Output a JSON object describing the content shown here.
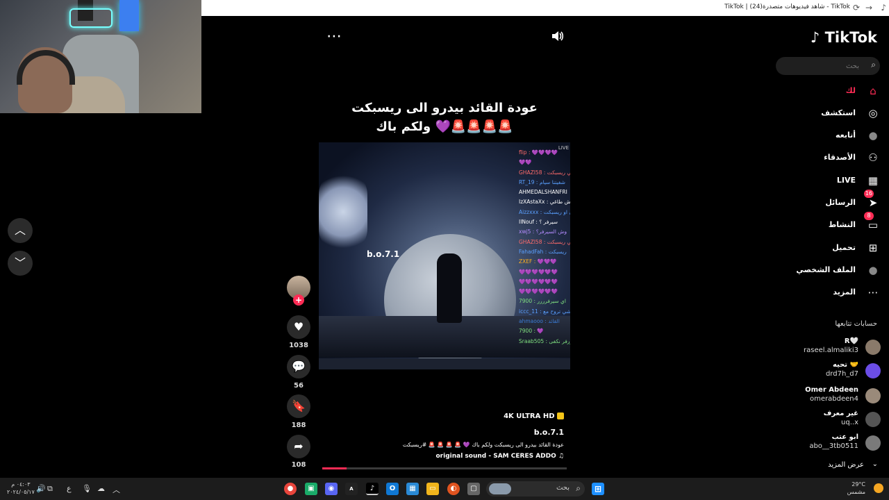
{
  "window": {
    "title": "TikTok | شاهد فيديوهات متصدرة(24) - TikTok",
    "reload_icon": "reload-icon",
    "forward_icon": "arrow-forward-icon",
    "app_icon": "tiktok-icon"
  },
  "feed_nav": {
    "up_icon": "chevron-up-icon",
    "down_icon": "chevron-down-icon"
  },
  "video": {
    "caption_overlay": [
      "عودة القائد بيدرو الى ريسبكت",
      "ولكم باك 💜🚨🚨🚨🚨"
    ],
    "watermark": "b.o.7.1",
    "live_label": "LIVE",
    "chat_lines": [
      {
        "text": "flip : 💜💜💜💜",
        "color": "#ff6b6b"
      },
      {
        "text": "💜💜",
        "color": "#b58cff"
      },
      {
        "text": "GHAZI58 : نبي ريسبكت",
        "color": "#ff6b6b"
      },
      {
        "text": "RT_19 : شفيتنا سيام",
        "color": "#5aa0ff"
      },
      {
        "text": "AHMEDALSHANFRI",
        "color": "#ffffff"
      },
      {
        "text": "IzXAstaXx : وش طاغي",
        "color": "#ffffff"
      },
      {
        "text": "Aizzxxx : تي او ريسبكت",
        "color": "#5aa0ff"
      },
      {
        "text": "IINouf : سيرفر ؟",
        "color": "#ffffff"
      },
      {
        "text": "xwj5 : وش السيرفر؟",
        "color": "#b58cff"
      },
      {
        "text": "GHAZI58 : نبي ريسبكت",
        "color": "#ff6b6b"
      },
      {
        "text": "FahadFah : ريسبكت",
        "color": "#5aa0ff"
      },
      {
        "text": "ZXEF : 💜💜💜",
        "color": "#ffb020"
      },
      {
        "text": "💜💜💜💜💜💜",
        "color": "#b58cff"
      },
      {
        "text": "💜💜💜💜💜💜",
        "color": "#b58cff"
      },
      {
        "text": "💜💜💜💜💜💜",
        "color": "#b58cff"
      },
      {
        "text": "7900 : اي سيرفرررر",
        "color": "#7fe07f"
      },
      {
        "text": "iccc_11 : شي تروح مع",
        "color": "#5aa0ff"
      },
      {
        "text": "ahmaooo : القائد",
        "color": "#3a7bd5"
      },
      {
        "text": "7900 : 💜",
        "color": "#7fe07f"
      },
      {
        "text": "Sraab505 : ررفر نكفى",
        "color": "#7fe07f"
      }
    ],
    "menu_icon": "more-horizontal-icon",
    "sound_icon": "speaker-icon"
  },
  "actions": {
    "like_count": "1038",
    "comment_count": "56",
    "save_count": "188",
    "share_count": "108",
    "like_icon": "heart-icon",
    "comment_icon": "comment-icon",
    "save_icon": "bookmark-icon",
    "share_icon": "share-icon",
    "follow_icon": "plus-icon"
  },
  "description": {
    "quality_badge": "4K ULTRA HD",
    "author": "b.o.7.1",
    "text": "عودة القائد بيدرو الى ريسبكت  ولكم باك 💜 🚨 🚨 🚨 🚨 #ريسبكت",
    "sound": "original sound - SAM CERES ADDO",
    "progress": 0.1
  },
  "sidebar": {
    "logo": "TikTok",
    "search_placeholder": "بحث",
    "nav": [
      {
        "label": "لك",
        "icon": "home-icon",
        "active": true
      },
      {
        "label": "استكشف",
        "icon": "compass-icon"
      },
      {
        "label": "أتابعه",
        "icon": "following-avatar-icon"
      },
      {
        "label": "الأصدقاء",
        "icon": "friends-icon"
      },
      {
        "label": "LIVE",
        "icon": "live-icon"
      },
      {
        "label": "الرسائل",
        "icon": "send-icon",
        "badge": "16"
      },
      {
        "label": "النشاط",
        "icon": "inbox-icon",
        "badge": "8"
      },
      {
        "label": "تحميل",
        "icon": "upload-icon"
      },
      {
        "label": "الملف الشخصي",
        "icon": "profile-avatar-icon"
      },
      {
        "label": "المزيد",
        "icon": "more-icon"
      }
    ],
    "following_header": "حسابات تتابعها",
    "accounts": [
      {
        "name": "R🤍",
        "handle": "raseel.almaliki3"
      },
      {
        "name": "تحيه 🤝",
        "handle": "drd7h_d7"
      },
      {
        "name": "Omer Abdeen",
        "handle": "omerabdeen4"
      },
      {
        "name": "غير معرف",
        "handle": "uq..x"
      },
      {
        "name": "ابو عتب",
        "handle": "abo__3tb0511"
      }
    ],
    "show_more": "عرض المزيد"
  },
  "taskbar": {
    "clock_time": "٠٤:٠٣ م",
    "clock_date": "٢٠٢٤/٠٥/١٧",
    "lang": "ع",
    "search_label": "بحث",
    "weather_temp": "29°C",
    "weather_desc": "مشمس"
  }
}
